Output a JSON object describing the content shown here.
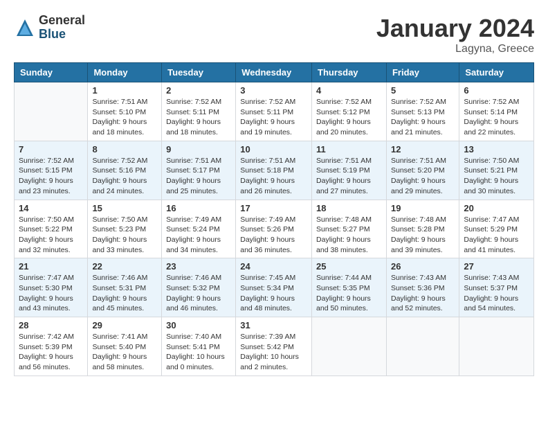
{
  "header": {
    "logo_general": "General",
    "logo_blue": "Blue",
    "month_title": "January 2024",
    "location": "Lagyna, Greece"
  },
  "days_of_week": [
    "Sunday",
    "Monday",
    "Tuesday",
    "Wednesday",
    "Thursday",
    "Friday",
    "Saturday"
  ],
  "weeks": [
    [
      {
        "day": "",
        "info": ""
      },
      {
        "day": "1",
        "info": "Sunrise: 7:51 AM\nSunset: 5:10 PM\nDaylight: 9 hours\nand 18 minutes."
      },
      {
        "day": "2",
        "info": "Sunrise: 7:52 AM\nSunset: 5:11 PM\nDaylight: 9 hours\nand 18 minutes."
      },
      {
        "day": "3",
        "info": "Sunrise: 7:52 AM\nSunset: 5:11 PM\nDaylight: 9 hours\nand 19 minutes."
      },
      {
        "day": "4",
        "info": "Sunrise: 7:52 AM\nSunset: 5:12 PM\nDaylight: 9 hours\nand 20 minutes."
      },
      {
        "day": "5",
        "info": "Sunrise: 7:52 AM\nSunset: 5:13 PM\nDaylight: 9 hours\nand 21 minutes."
      },
      {
        "day": "6",
        "info": "Sunrise: 7:52 AM\nSunset: 5:14 PM\nDaylight: 9 hours\nand 22 minutes."
      }
    ],
    [
      {
        "day": "7",
        "info": "Sunrise: 7:52 AM\nSunset: 5:15 PM\nDaylight: 9 hours\nand 23 minutes."
      },
      {
        "day": "8",
        "info": "Sunrise: 7:52 AM\nSunset: 5:16 PM\nDaylight: 9 hours\nand 24 minutes."
      },
      {
        "day": "9",
        "info": "Sunrise: 7:51 AM\nSunset: 5:17 PM\nDaylight: 9 hours\nand 25 minutes."
      },
      {
        "day": "10",
        "info": "Sunrise: 7:51 AM\nSunset: 5:18 PM\nDaylight: 9 hours\nand 26 minutes."
      },
      {
        "day": "11",
        "info": "Sunrise: 7:51 AM\nSunset: 5:19 PM\nDaylight: 9 hours\nand 27 minutes."
      },
      {
        "day": "12",
        "info": "Sunrise: 7:51 AM\nSunset: 5:20 PM\nDaylight: 9 hours\nand 29 minutes."
      },
      {
        "day": "13",
        "info": "Sunrise: 7:50 AM\nSunset: 5:21 PM\nDaylight: 9 hours\nand 30 minutes."
      }
    ],
    [
      {
        "day": "14",
        "info": "Sunrise: 7:50 AM\nSunset: 5:22 PM\nDaylight: 9 hours\nand 32 minutes."
      },
      {
        "day": "15",
        "info": "Sunrise: 7:50 AM\nSunset: 5:23 PM\nDaylight: 9 hours\nand 33 minutes."
      },
      {
        "day": "16",
        "info": "Sunrise: 7:49 AM\nSunset: 5:24 PM\nDaylight: 9 hours\nand 34 minutes."
      },
      {
        "day": "17",
        "info": "Sunrise: 7:49 AM\nSunset: 5:26 PM\nDaylight: 9 hours\nand 36 minutes."
      },
      {
        "day": "18",
        "info": "Sunrise: 7:48 AM\nSunset: 5:27 PM\nDaylight: 9 hours\nand 38 minutes."
      },
      {
        "day": "19",
        "info": "Sunrise: 7:48 AM\nSunset: 5:28 PM\nDaylight: 9 hours\nand 39 minutes."
      },
      {
        "day": "20",
        "info": "Sunrise: 7:47 AM\nSunset: 5:29 PM\nDaylight: 9 hours\nand 41 minutes."
      }
    ],
    [
      {
        "day": "21",
        "info": "Sunrise: 7:47 AM\nSunset: 5:30 PM\nDaylight: 9 hours\nand 43 minutes."
      },
      {
        "day": "22",
        "info": "Sunrise: 7:46 AM\nSunset: 5:31 PM\nDaylight: 9 hours\nand 45 minutes."
      },
      {
        "day": "23",
        "info": "Sunrise: 7:46 AM\nSunset: 5:32 PM\nDaylight: 9 hours\nand 46 minutes."
      },
      {
        "day": "24",
        "info": "Sunrise: 7:45 AM\nSunset: 5:34 PM\nDaylight: 9 hours\nand 48 minutes."
      },
      {
        "day": "25",
        "info": "Sunrise: 7:44 AM\nSunset: 5:35 PM\nDaylight: 9 hours\nand 50 minutes."
      },
      {
        "day": "26",
        "info": "Sunrise: 7:43 AM\nSunset: 5:36 PM\nDaylight: 9 hours\nand 52 minutes."
      },
      {
        "day": "27",
        "info": "Sunrise: 7:43 AM\nSunset: 5:37 PM\nDaylight: 9 hours\nand 54 minutes."
      }
    ],
    [
      {
        "day": "28",
        "info": "Sunrise: 7:42 AM\nSunset: 5:39 PM\nDaylight: 9 hours\nand 56 minutes."
      },
      {
        "day": "29",
        "info": "Sunrise: 7:41 AM\nSunset: 5:40 PM\nDaylight: 9 hours\nand 58 minutes."
      },
      {
        "day": "30",
        "info": "Sunrise: 7:40 AM\nSunset: 5:41 PM\nDaylight: 10 hours\nand 0 minutes."
      },
      {
        "day": "31",
        "info": "Sunrise: 7:39 AM\nSunset: 5:42 PM\nDaylight: 10 hours\nand 2 minutes."
      },
      {
        "day": "",
        "info": ""
      },
      {
        "day": "",
        "info": ""
      },
      {
        "day": "",
        "info": ""
      }
    ]
  ]
}
